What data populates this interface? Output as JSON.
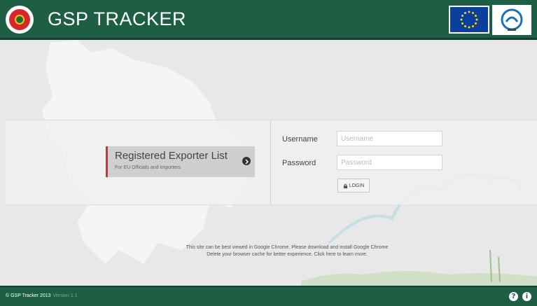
{
  "header": {
    "title": "GSP TRACKER",
    "logo_icon": "bangladesh-emblem-icon",
    "eu_flag_icon": "eu-flag-icon",
    "partner_logo_icon": "partner-org-logo-icon",
    "brand_color": "#1e5e45"
  },
  "exporter_card": {
    "title": "Registered Exporter List",
    "subtitle": "For EU Officials and Importers",
    "accent_color": "#c8333d",
    "icon": "chevron-right-circle-icon"
  },
  "login_form": {
    "username_label": "Username",
    "username_placeholder": "Username",
    "username_value": "",
    "password_label": "Password",
    "password_placeholder": "Password",
    "password_value": "",
    "login_label": "LOGIN",
    "login_icon": "lock-icon"
  },
  "notice": {
    "line1": "This site can be best viewed in Google Chrome. Please download and install Google Chrome",
    "line2": "Delete your browser cache for better experience. Click here to learn more."
  },
  "footer": {
    "copyright": "© GSP Tracker 2013",
    "version": "Version 1.1",
    "help_icon": "help-icon",
    "info_icon": "info-icon"
  }
}
